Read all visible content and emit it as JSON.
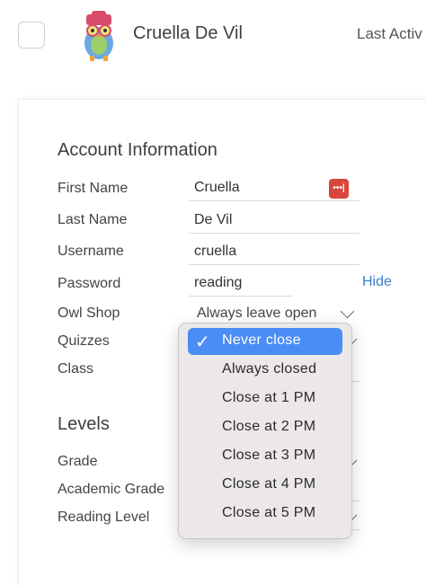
{
  "header": {
    "user_name": "Cruella De Vil",
    "last_active_label": "Last Activ"
  },
  "account": {
    "title": "Account Information",
    "first_name_label": "First Name",
    "first_name_value": "Cruella",
    "last_name_label": "Last Name",
    "last_name_value": "De Vil",
    "username_label": "Username",
    "username_value": "cruella",
    "password_label": "Password",
    "password_value": "reading",
    "password_icon_text": "•••|",
    "hide_label": "Hide",
    "owl_shop_label": "Owl Shop",
    "owl_shop_value": "Always leave open",
    "quizzes_label": "Quizzes",
    "class_label": "Class"
  },
  "levels": {
    "title": "Levels",
    "grade_label": "Grade",
    "academic_grade_label": "Academic Grade",
    "reading_level_label": "Reading Level"
  },
  "dropdown": {
    "options": [
      "Never close",
      "Always closed",
      "Close at 1 PM",
      "Close at 2 PM",
      "Close at 3 PM",
      "Close at 4 PM",
      "Close at 5 PM"
    ],
    "selected": "Never close",
    "accent_color": "#4a8df5"
  },
  "icons": {
    "checkbox": "checkbox-icon",
    "avatar": "owl-avatar",
    "password_manager": "password-manager-icon",
    "check": "check-icon",
    "chevron": "chevron-down-icon"
  }
}
